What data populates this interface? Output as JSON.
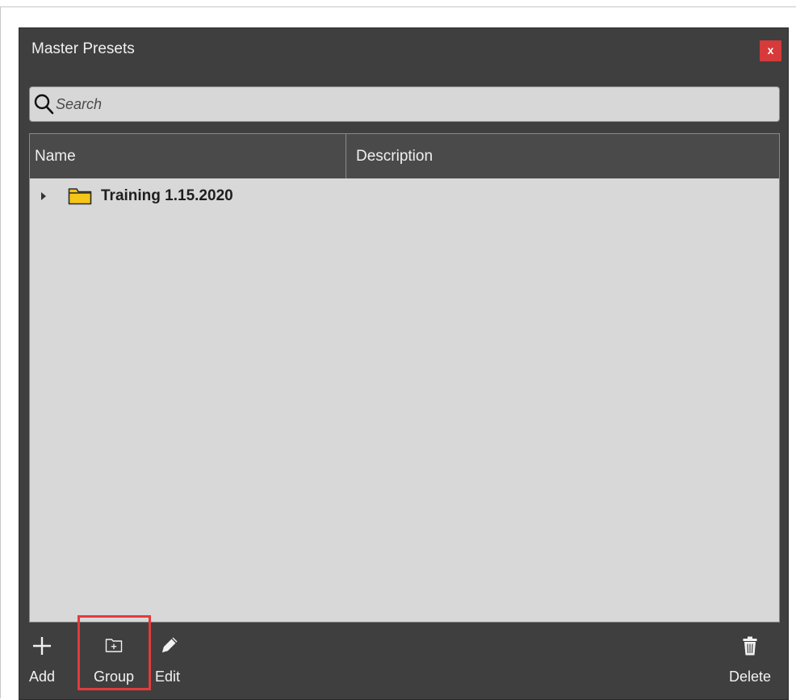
{
  "window": {
    "title": "Master Presets",
    "close_label": "x"
  },
  "search": {
    "placeholder": "Search",
    "value": ""
  },
  "table": {
    "columns": [
      "Name",
      "Description"
    ],
    "rows": [
      {
        "name": "Training 1.15.2020",
        "description": "",
        "type": "folder",
        "expanded": false
      }
    ]
  },
  "toolbar": {
    "add_label": "Add",
    "group_label": "Group",
    "edit_label": "Edit",
    "delete_label": "Delete",
    "highlighted": "Group"
  },
  "icons": {
    "search": "search-icon",
    "folder": "folder-icon",
    "add": "plus-icon",
    "group": "folder-add-icon",
    "edit": "pencil-icon",
    "delete": "trash-icon"
  },
  "colors": {
    "window_bg": "#3f3f3f",
    "close_button": "#d63a3a",
    "list_bg": "#d8d8d8",
    "folder": "#f5c518",
    "highlight_box": "#e23b3b"
  }
}
